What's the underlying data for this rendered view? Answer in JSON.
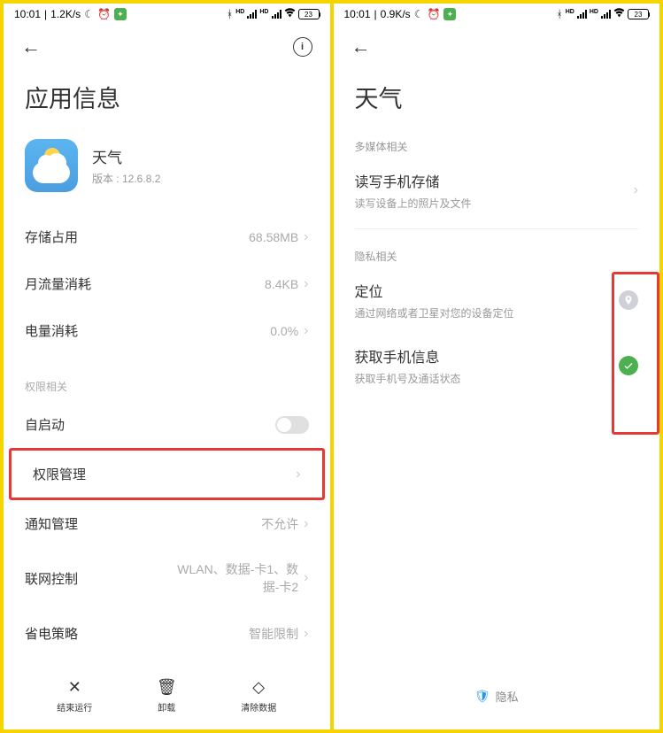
{
  "left": {
    "status": {
      "time": "10:01",
      "speed": "1.2K/s",
      "battery": "23"
    },
    "page_title": "应用信息",
    "app": {
      "name": "天气",
      "version": "版本 : 12.6.8.2"
    },
    "rows": {
      "storage": {
        "label": "存储占用",
        "value": "68.58MB"
      },
      "data": {
        "label": "月流量消耗",
        "value": "8.4KB"
      },
      "battery": {
        "label": "电量消耗",
        "value": "0.0%"
      }
    },
    "section_permissions": "权限相关",
    "autostart": {
      "label": "自启动"
    },
    "perm_mgmt": {
      "label": "权限管理"
    },
    "notif_mgmt": {
      "label": "通知管理",
      "value": "不允许"
    },
    "network": {
      "label": "联网控制",
      "value": "WLAN、数据-卡1、数据-卡2"
    },
    "power_policy": {
      "label": "省电策略",
      "value": "智能限制"
    },
    "bottom": {
      "stop": "结束运行",
      "uninstall": "卸载",
      "clear": "清除数据"
    }
  },
  "right": {
    "status": {
      "time": "10:01",
      "speed": "0.9K/s",
      "battery": "23"
    },
    "page_title": "天气",
    "section_media": "多媒体相关",
    "storage_perm": {
      "title": "读写手机存储",
      "desc": "读写设备上的照片及文件"
    },
    "section_privacy": "隐私相关",
    "location_perm": {
      "title": "定位",
      "desc": "通过网络或者卫星对您的设备定位"
    },
    "phone_perm": {
      "title": "获取手机信息",
      "desc": "获取手机号及通话状态"
    },
    "footer": "隐私"
  }
}
